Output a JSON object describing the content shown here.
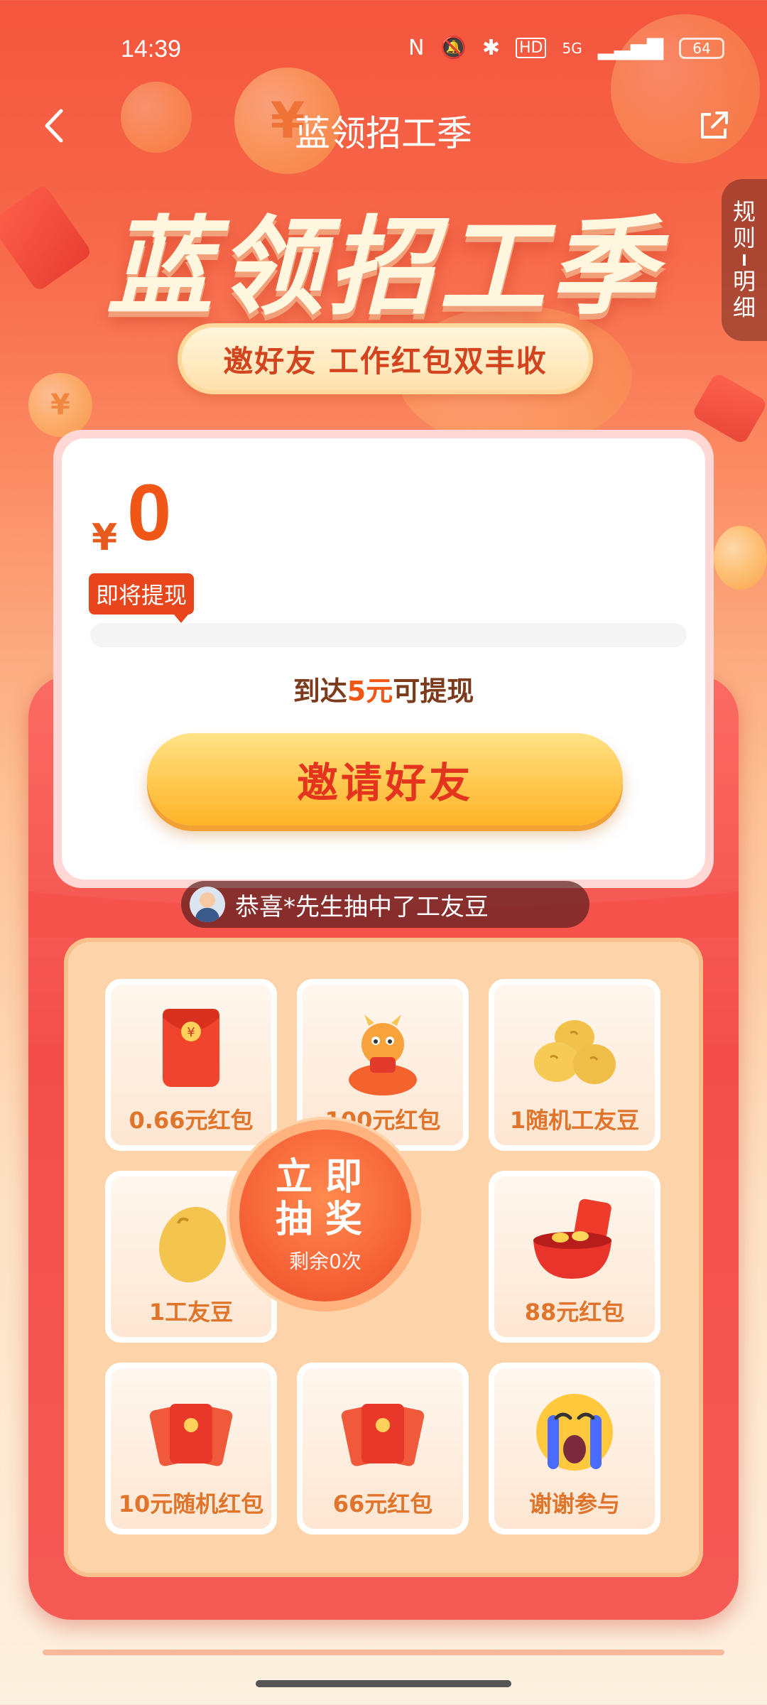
{
  "status_bar": {
    "time": "14:39",
    "network": "5G",
    "battery": "64"
  },
  "nav": {
    "title": "蓝领招工季",
    "back_icon": "chevron-left-icon",
    "share_icon": "share-icon"
  },
  "hero": {
    "title": "蓝领招工季",
    "subtitle": "邀好友 工作红包双丰收"
  },
  "rules_tab": {
    "line1": "规",
    "line2": "则",
    "line3": "明",
    "line4": "细"
  },
  "wallet": {
    "currency": "¥",
    "amount": "0",
    "tag": "即将提现",
    "progress_fraction": 0,
    "progress_prefix": "到达",
    "progress_highlight": "5元",
    "progress_suffix": "可提现",
    "invite_button": "邀请好友"
  },
  "ticker": {
    "text": "恭喜*先生抽中了工友豆"
  },
  "prizes": [
    {
      "label": "0.66元红包",
      "icon": "red-envelope-icon"
    },
    {
      "label": "100元红包",
      "icon": "dragon-mascot-icon"
    },
    {
      "label": "1随机工友豆",
      "icon": "beans-icon"
    },
    {
      "label": "1工友豆",
      "icon": "bean-icon"
    },
    {
      "label": "88元红包",
      "icon": "bowl-envelope-icon"
    },
    {
      "label": "10元随机红包",
      "icon": "envelopes-icon"
    },
    {
      "label": "66元红包",
      "icon": "envelopes-icon"
    },
    {
      "label": "谢谢参与",
      "icon": "crying-face-icon"
    }
  ],
  "draw": {
    "line1": "立即",
    "line2": "抽奖",
    "remaining": "剩余0次"
  },
  "colors": {
    "accent": "#f05716",
    "invite_text": "#e4341e",
    "prize_label": "#e0742a"
  }
}
